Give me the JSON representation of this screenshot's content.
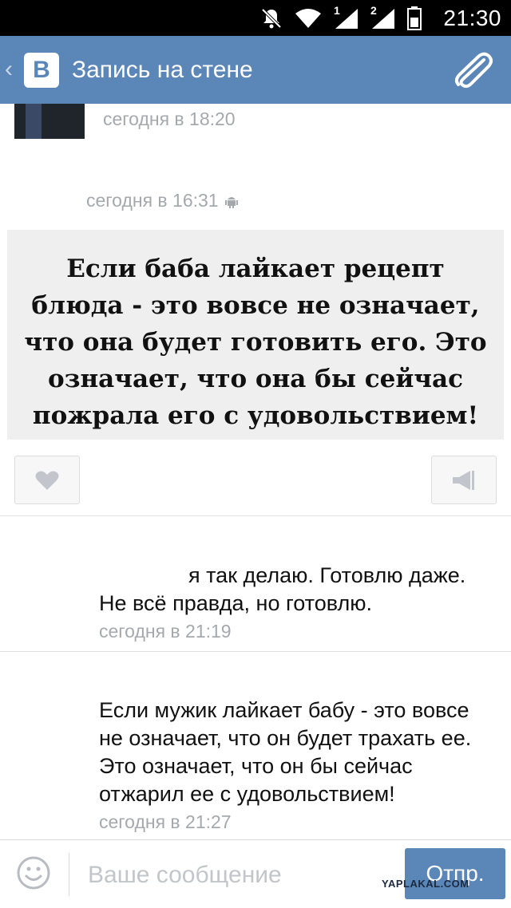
{
  "statusbar": {
    "time": "21:30",
    "icons": [
      "mute-icon",
      "wifi-icon",
      "signal-1-icon",
      "signal-2-icon",
      "battery-icon"
    ],
    "sim1_label": "1",
    "sim2_label": "2"
  },
  "toolbar": {
    "back_chevron": "‹",
    "logo": "В",
    "title": "Запись на стене",
    "accent": "#5b86b8"
  },
  "post": {
    "time": "сегодня в 18:20",
    "repost_time": "сегодня в 16:31",
    "image_text": "Если баба лайкает рецепт блюда - это вовсе не означает, что она будет готовить его. Это означает, что она бы сейчас пожрала его с удовольствием!"
  },
  "comments": [
    {
      "text_line1": "я так делаю. Готовлю даже.",
      "text_line2": "Не всё правда, но готовлю.",
      "time": "сегодня в 21:19"
    },
    {
      "text": "Если мужик лайкает бабу - это вовсе не означает, что он будет трахать ее. Это означает, что он бы сейчас отжарил ее с удовольствием!",
      "time": "сегодня в 21:27"
    }
  ],
  "composer": {
    "placeholder": "Ваше сообщение",
    "send_label": "Отпр.",
    "watermark": "YAPLAKAL.COM"
  }
}
